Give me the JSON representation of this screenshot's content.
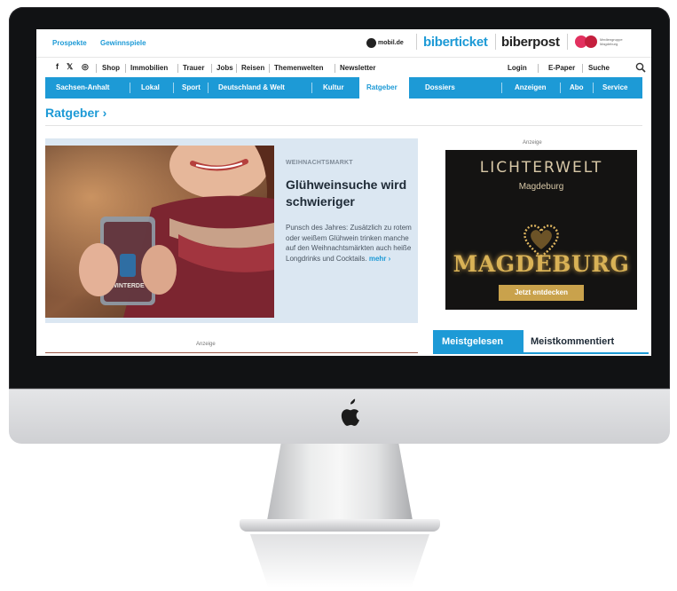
{
  "utility": {
    "links": [
      "Prospekte",
      "Gewinnspiele"
    ],
    "brands": {
      "mobil": "mobil.de",
      "biberticket": "biberticket",
      "biberpost": "biberpost",
      "mm_text": "Mediengruppe Magdeburg"
    }
  },
  "menu": {
    "social": [
      "f",
      "𝕏",
      "◎"
    ],
    "items": [
      "Shop",
      "Immobilien",
      "Trauer",
      "Jobs",
      "Reisen",
      "Themenwelten",
      "Newsletter"
    ],
    "right_items": [
      "Login",
      "E-Paper",
      "Suche"
    ]
  },
  "nav": {
    "items": [
      "Sachsen-Anhalt",
      "Lokal",
      "Sport",
      "Deutschland & Welt",
      "Kultur",
      "Ratgeber",
      "Dossiers",
      "Anzeigen",
      "Abo",
      "Service"
    ],
    "active": "Ratgeber"
  },
  "section": {
    "title": "Ratgeber ›"
  },
  "teaser": {
    "kicker": "WEIHNACHTSMARKT",
    "headline": "Glühweinsuche wird schwieriger",
    "text": "Punsch des Jahres: Zusätzlich zu rotem oder weißem Glühwein trinken manche auf den Weihnachtsmärkten auch heiße Longdrinks und Cocktails.",
    "more": "mehr ›",
    "mug_text": "WINTERDE"
  },
  "ad": {
    "label": "Anzeige",
    "title": "LICHTERWELT",
    "subtitle": "Magdeburg",
    "big": "MAGDEBURG",
    "button": "Jetzt entdecken"
  },
  "bottom": {
    "anzeige": "Anzeige"
  },
  "tabs": {
    "active": "Meistgelesen",
    "inactive": "Meistkommentiert"
  },
  "colors": {
    "brand_blue": "#1d9ad6",
    "teaser_bg": "#dbe7f2",
    "ad_gold": "#c9a24c"
  },
  "icons": {
    "search": "search-icon",
    "apple": "apple-logo"
  }
}
